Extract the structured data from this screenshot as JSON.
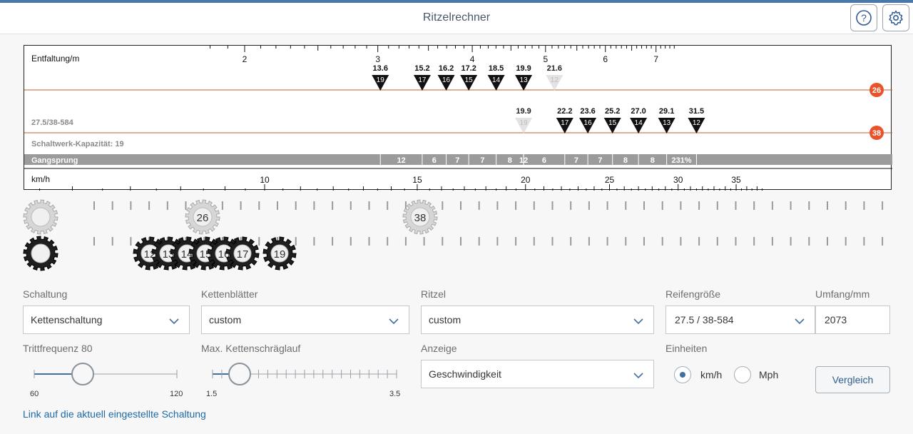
{
  "header": {
    "title": "Ritzelrechner",
    "help_icon": "help-circle-icon",
    "settings_icon": "gear-settings-icon"
  },
  "chart": {
    "top_axis_label": "Entfaltung/m",
    "top_ticks": [
      {
        "label": "2",
        "v": 2
      },
      {
        "label": "3",
        "v": 3
      },
      {
        "label": "4",
        "v": 4
      },
      {
        "label": "5",
        "v": 5
      },
      {
        "label": "6",
        "v": 6
      },
      {
        "label": "7",
        "v": 7
      }
    ],
    "bottom_axis_label": "km/h",
    "bottom_ticks": [
      {
        "label": "10",
        "v": 10
      },
      {
        "label": "15",
        "v": 15
      },
      {
        "label": "20",
        "v": 20
      },
      {
        "label": "25",
        "v": 25
      },
      {
        "label": "30",
        "v": 30
      },
      {
        "label": "35",
        "v": 35
      }
    ],
    "rows": [
      {
        "chainring": "26",
        "markers": [
          {
            "value": "13.6",
            "teeth": "19",
            "dim": false
          },
          {
            "value": "15.2",
            "teeth": "17",
            "dim": false
          },
          {
            "value": "16.2",
            "teeth": "16",
            "dim": false
          },
          {
            "value": "17.2",
            "teeth": "15",
            "dim": false
          },
          {
            "value": "18.5",
            "teeth": "14",
            "dim": false
          },
          {
            "value": "19.9",
            "teeth": "13",
            "dim": false
          },
          {
            "value": "21.6",
            "teeth": "12",
            "dim": true
          }
        ]
      },
      {
        "chainring": "38",
        "markers": [
          {
            "value": "19.9",
            "teeth": "19",
            "dim": true
          },
          {
            "value": "22.2",
            "teeth": "17",
            "dim": false
          },
          {
            "value": "23.6",
            "teeth": "16",
            "dim": false
          },
          {
            "value": "25.2",
            "teeth": "15",
            "dim": false
          },
          {
            "value": "27.0",
            "teeth": "14",
            "dim": false
          },
          {
            "value": "29.1",
            "teeth": "13",
            "dim": false
          },
          {
            "value": "31.5",
            "teeth": "12",
            "dim": false
          }
        ]
      }
    ],
    "tire_label": "27.5/38-584",
    "capacity_label": "Schaltwerk-Kapazität: 19",
    "gangsprung_label": "Gangsprung",
    "gangsprung_values": [
      "12",
      "6",
      "7",
      "7",
      "8",
      "12",
      "6",
      "7",
      "7",
      "8",
      "8",
      "231%"
    ],
    "accent_color": "#e9532a"
  },
  "gears": {
    "chainrings": [
      "26",
      "38"
    ],
    "cassette": [
      "12",
      "13",
      "14",
      "15",
      "16",
      "17",
      "19"
    ]
  },
  "form": {
    "schaltung": {
      "label": "Schaltung",
      "value": "Kettenschaltung"
    },
    "kettenblaetter": {
      "label": "Kettenblätter",
      "value": "custom"
    },
    "ritzel": {
      "label": "Ritzel",
      "value": "custom"
    },
    "reifengroesse": {
      "label": "Reifengröße",
      "value": "27.5 / 38-584"
    },
    "umfang": {
      "label": "Umfang/mm",
      "value": "2073"
    },
    "trittfrequenz": {
      "label": "Trittfrequenz 80",
      "min": "60",
      "max": "120",
      "value": 80
    },
    "kettenschraeglauf": {
      "label": "Max. Kettenschräglauf",
      "min": "1.5",
      "max": "3.5",
      "value": 1.7
    },
    "anzeige": {
      "label": "Anzeige",
      "value": "Geschwindigkeit"
    },
    "einheiten": {
      "label": "Einheiten",
      "option_kmh": "km/h",
      "option_mph": "Mph",
      "selected": "km/h"
    },
    "vergleich_button": "Vergleich",
    "link_text": "Link auf die aktuell eingestellte Schaltung"
  }
}
